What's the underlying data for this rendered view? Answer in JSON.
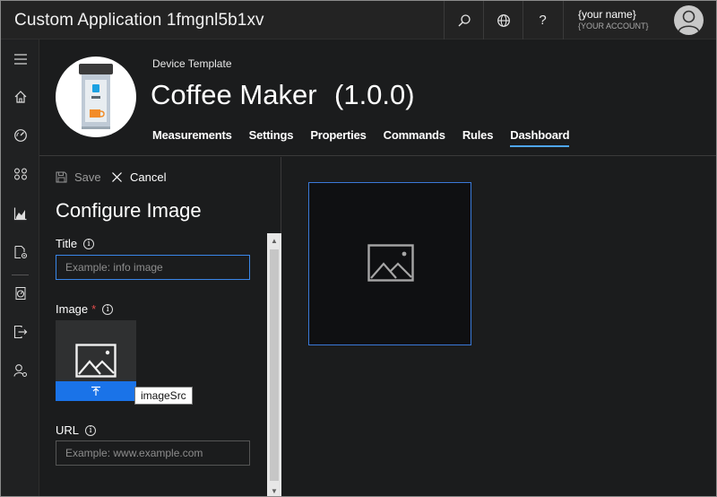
{
  "app": {
    "title": "Custom Application 1fmgnl5b1xv"
  },
  "topbar": {
    "buttons": [
      {
        "icon": "search-icon"
      },
      {
        "icon": "globe-icon"
      },
      {
        "icon": "help-icon",
        "label": "?"
      }
    ],
    "account": {
      "name": "{your name}",
      "account": "{YOUR ACCOUNT}"
    }
  },
  "leftnav": {
    "items": [
      "menu-icon",
      "home-icon",
      "dashboard-gauge-icon",
      "apps-grid-icon",
      "analytics-chart-icon",
      "device-template-icon",
      "gauge-document-icon",
      "export-icon",
      "user-settings-icon"
    ]
  },
  "header": {
    "breadcrumb": "Device Template",
    "title": "Coffee Maker",
    "version": "(1.0.0)",
    "tabs": [
      {
        "label": "Measurements",
        "active": false
      },
      {
        "label": "Settings",
        "active": false
      },
      {
        "label": "Properties",
        "active": false
      },
      {
        "label": "Commands",
        "active": false
      },
      {
        "label": "Rules",
        "active": false
      },
      {
        "label": "Dashboard",
        "active": true
      }
    ]
  },
  "panel": {
    "save_label": "Save",
    "cancel_label": "Cancel",
    "title": "Configure Image",
    "title_field": {
      "label": "Title",
      "placeholder": "Example: info image",
      "value": ""
    },
    "image_field": {
      "label": "Image",
      "required_mark": "*",
      "tooltip": "imageSrc"
    },
    "url_field": {
      "label": "URL",
      "placeholder": "Example: www.example.com",
      "value": ""
    }
  },
  "colors": {
    "accent": "#1a73e8",
    "tab_underline": "#4ea6f5",
    "required": "#e04b4b",
    "tile_border": "#3a79d8"
  }
}
